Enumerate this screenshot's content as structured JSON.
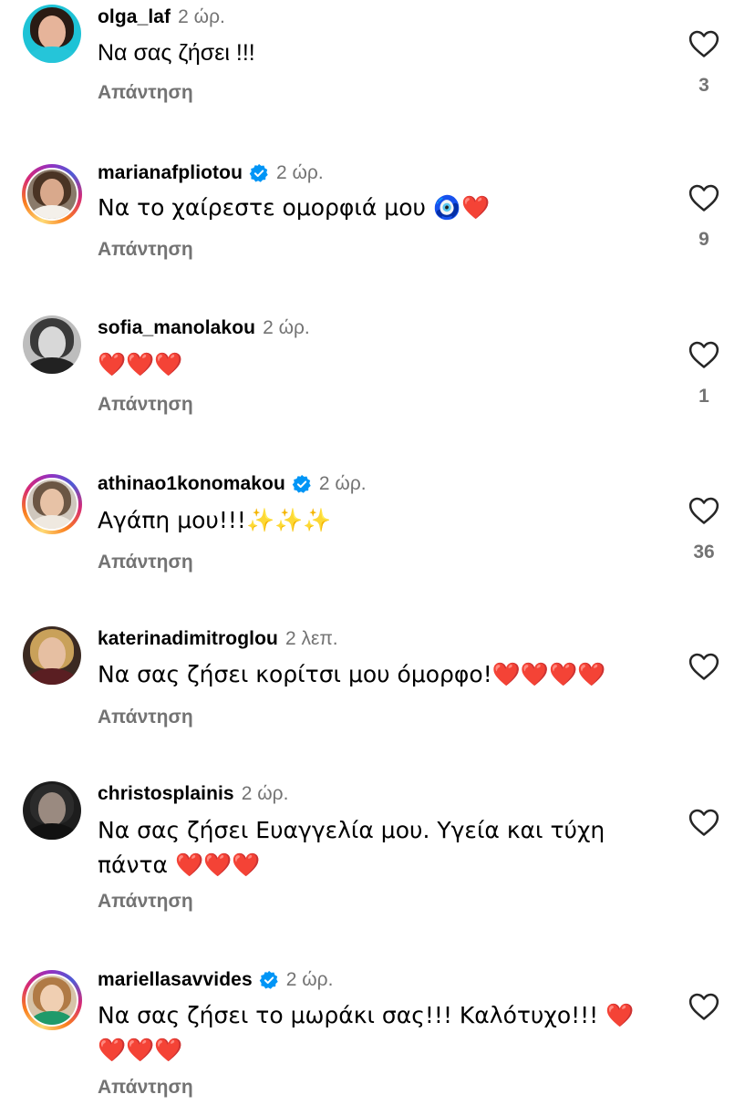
{
  "reply_label": "Απάντηση",
  "colors": {
    "secondary_text": "#737373",
    "verified": "#0095f6",
    "heart": "#e0162b"
  },
  "comments": [
    {
      "username": "olga_laf",
      "verified": false,
      "time": "2 ώρ.",
      "text": "Να σας ζήσει !!!",
      "likes": "3",
      "story_ring": false
    },
    {
      "username": "marianafpliotou",
      "verified": true,
      "time": "2 ώρ.",
      "text": "Να το χαίρεστε ομορφιά μου 🧿❤️",
      "likes": "9",
      "story_ring": true
    },
    {
      "username": "sofia_manolakou",
      "verified": false,
      "time": "2 ώρ.",
      "text": "❤️❤️❤️",
      "likes": "1",
      "story_ring": false
    },
    {
      "username": "athinao1konomakou",
      "verified": true,
      "time": "2 ώρ.",
      "text": "Αγάπη μου!!!✨✨✨",
      "likes": "36",
      "story_ring": true
    },
    {
      "username": "katerinadimitroglou",
      "verified": false,
      "time": "2 λεπ.",
      "text": "Να σας ζήσει κορίτσι μου όμορφο!❤️❤️❤️❤️",
      "likes": "",
      "story_ring": false
    },
    {
      "username": "christosplainis",
      "verified": false,
      "time": "2 ώρ.",
      "text": "Να σας ζήσει Ευαγγελία μου. Υγεία και τύχη πάντα ❤️❤️❤️",
      "likes": "",
      "story_ring": false
    },
    {
      "username": "mariellasavvides",
      "verified": true,
      "time": "2 ώρ.",
      "text": "Να σας ζήσει το μωράκι σας!!! Καλότυχο!!! ❤️ ❤️❤️❤️",
      "likes": "",
      "story_ring": true
    }
  ]
}
